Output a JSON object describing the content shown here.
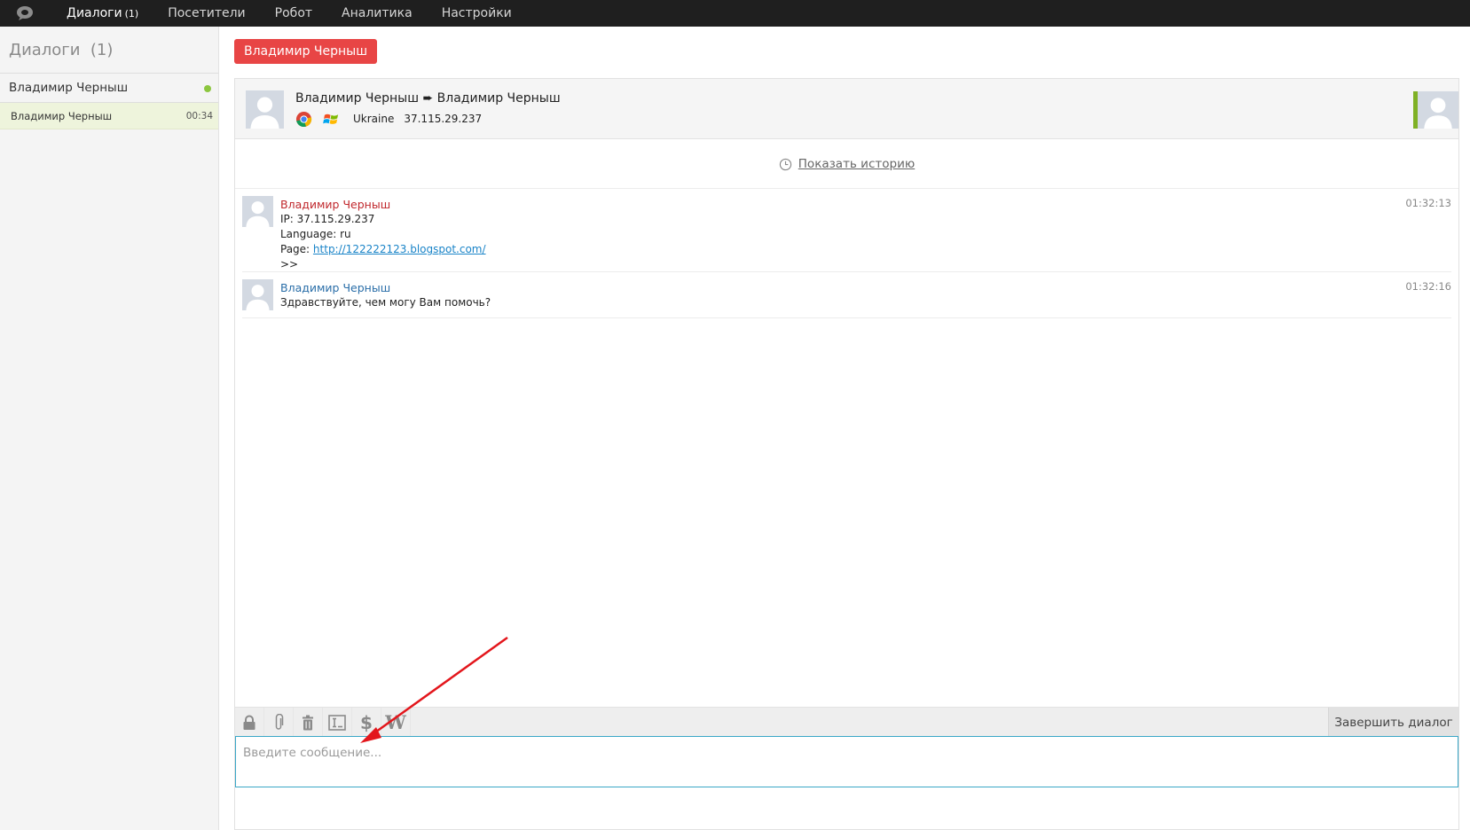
{
  "nav": {
    "items": [
      {
        "label": "Диалоги",
        "count": "(1)"
      },
      {
        "label": "Посетители"
      },
      {
        "label": "Робот"
      },
      {
        "label": "Аналитика"
      },
      {
        "label": "Настройки"
      }
    ]
  },
  "sidebar": {
    "title": "Диалоги  (1)",
    "group": {
      "name": "Владимир Черныш",
      "status_color": "#8cc63f"
    },
    "dialog": {
      "name": "Владимир Черныш",
      "time": "00:34"
    }
  },
  "visitor_tab": "Владимир Черныш",
  "chat_header": {
    "title": "Владимир Черныш ➨ Владимир Черныш",
    "country": "Ukraine",
    "ip": "37.115.29.237",
    "browser_icon": "chrome-icon",
    "os_icon": "windows-icon"
  },
  "history": {
    "label": "Показать историю"
  },
  "messages": [
    {
      "author": "Владимир Черныш",
      "role": "visitor",
      "time": "01:32:13",
      "ip_line": "IP: 37.115.29.237",
      "lang_line": "Language: ru",
      "page_label": "Page: ",
      "page_url": "http://122222123.blogspot.com/",
      "tail": ">>"
    },
    {
      "author": "Владимир Черныш",
      "role": "operator",
      "time": "01:32:16",
      "text": "Здравствуйте, чем могу Вам помочь?"
    }
  ],
  "toolbar": {
    "tools": [
      "lock-icon",
      "paperclip-icon",
      "trash-icon",
      "template-icon",
      "dollar-icon",
      "wikipedia-icon"
    ],
    "dollar": "$",
    "wiki": "W",
    "end_dialog": "Завершить диалог"
  },
  "input": {
    "placeholder": "Введите сообщение...",
    "value": ""
  },
  "colors": {
    "accent": "#e84545",
    "visitor_name": "#c0282d",
    "operator_name": "#2a6ea8",
    "operator_status": "#7fb125",
    "input_border": "#3aa7c7",
    "annotation_arrow": "#e3161c"
  }
}
